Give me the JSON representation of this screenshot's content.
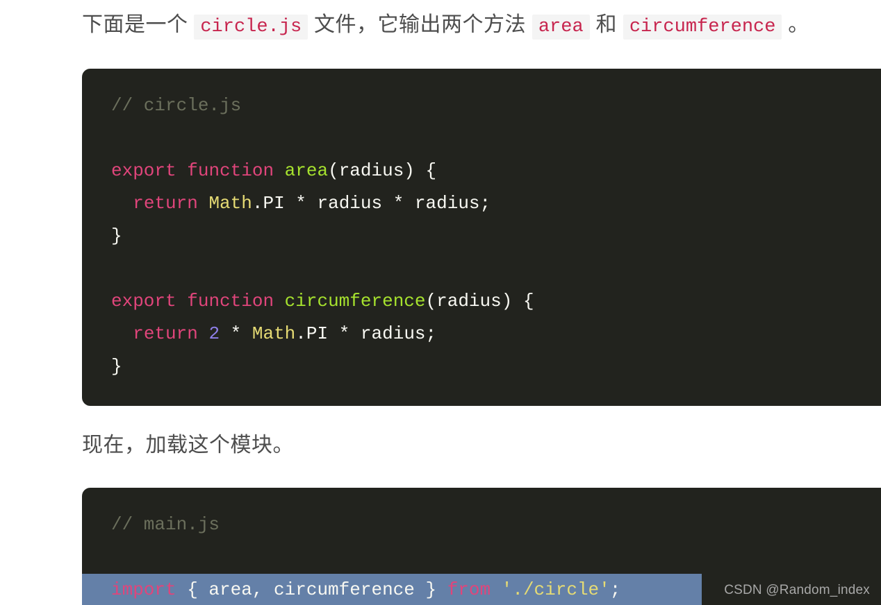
{
  "paragraphs": {
    "intro": {
      "segment_1": "下面是一个 ",
      "code_1": "circle.js",
      "segment_2": " 文件，它输出两个方法 ",
      "code_2": "area",
      "segment_3": " 和 ",
      "code_3": "circumference",
      "segment_4": " 。"
    },
    "middle": {
      "text": "现在，加载这个模块。"
    }
  },
  "code_blocks": [
    {
      "name": "circle-js",
      "filename": "circle.js",
      "language": "javascript",
      "lines": [
        {
          "tokens": [
            {
              "t": "// circle.js",
              "c": "comment"
            }
          ]
        },
        {
          "tokens": []
        },
        {
          "tokens": [
            {
              "t": "export",
              "c": "keyword"
            },
            {
              "t": " ",
              "c": "plain"
            },
            {
              "t": "function",
              "c": "keyword"
            },
            {
              "t": " ",
              "c": "plain"
            },
            {
              "t": "area",
              "c": "func"
            },
            {
              "t": "(radius) {",
              "c": "plain"
            }
          ]
        },
        {
          "tokens": [
            {
              "t": "  ",
              "c": "plain"
            },
            {
              "t": "return",
              "c": "keyword"
            },
            {
              "t": " ",
              "c": "plain"
            },
            {
              "t": "Math",
              "c": "class"
            },
            {
              "t": ".PI * radius * radius;",
              "c": "plain"
            }
          ]
        },
        {
          "tokens": [
            {
              "t": "}",
              "c": "plain"
            }
          ]
        },
        {
          "tokens": []
        },
        {
          "tokens": [
            {
              "t": "export",
              "c": "keyword"
            },
            {
              "t": " ",
              "c": "plain"
            },
            {
              "t": "function",
              "c": "keyword"
            },
            {
              "t": " ",
              "c": "plain"
            },
            {
              "t": "circumference",
              "c": "func"
            },
            {
              "t": "(radius) {",
              "c": "plain"
            }
          ]
        },
        {
          "tokens": [
            {
              "t": "  ",
              "c": "plain"
            },
            {
              "t": "return",
              "c": "keyword"
            },
            {
              "t": " ",
              "c": "plain"
            },
            {
              "t": "2",
              "c": "number"
            },
            {
              "t": " * ",
              "c": "plain"
            },
            {
              "t": "Math",
              "c": "class"
            },
            {
              "t": ".PI * radius;",
              "c": "plain"
            }
          ]
        },
        {
          "tokens": [
            {
              "t": "}",
              "c": "plain"
            }
          ]
        }
      ]
    },
    {
      "name": "main-js",
      "filename": "main.js",
      "language": "javascript",
      "lines": [
        {
          "tokens": [
            {
              "t": "// main.js",
              "c": "comment"
            }
          ]
        },
        {
          "tokens": []
        },
        {
          "highlighted": true,
          "tokens": [
            {
              "t": "import",
              "c": "keyword"
            },
            {
              "t": " { area, circumference } ",
              "c": "plain"
            },
            {
              "t": "from",
              "c": "keyword"
            },
            {
              "t": " ",
              "c": "plain"
            },
            {
              "t": "'./circle'",
              "c": "string"
            },
            {
              "t": ";",
              "c": "plain"
            }
          ]
        }
      ]
    }
  ],
  "watermark": {
    "text": "CSDN @Random_index"
  },
  "colors": {
    "page_background": "#ffffff",
    "code_background": "#22231e",
    "prose_text": "#4d4d4d",
    "inline_code_text": "#c7254e",
    "inline_code_background": "#f4f4f4",
    "keyword": "#e0457b",
    "function_name": "#a6e22e",
    "class_name": "#e6db74",
    "number": "#8e7fe8",
    "string": "#e6db74",
    "comment": "#6b6f5c",
    "plain_code": "#f8f8f2",
    "selection_highlight": "#6480a8",
    "watermark_text": "#a8a8a8"
  }
}
